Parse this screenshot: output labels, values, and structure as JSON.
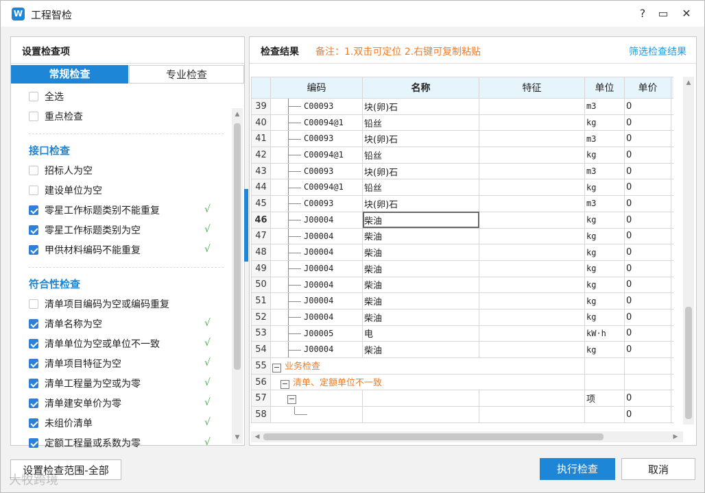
{
  "window": {
    "title": "工程智检",
    "logo": "W",
    "help": "?",
    "maximize": "▭",
    "close": "✕"
  },
  "left": {
    "title": "设置检查项",
    "tabs": [
      "常规检查",
      "专业检查"
    ],
    "items": [
      {
        "label": "全选",
        "checked": false
      },
      {
        "label": "重点检查",
        "checked": false
      }
    ],
    "sections": [
      {
        "title": "接口检查",
        "items": [
          {
            "label": "招标人为空",
            "checked": false
          },
          {
            "label": "建设单位为空",
            "checked": false
          },
          {
            "label": "零星工作标题类别不能重复",
            "checked": true
          },
          {
            "label": "零星工作标题类别为空",
            "checked": true
          },
          {
            "label": "甲供材料编码不能重复",
            "checked": true
          }
        ]
      },
      {
        "title": "符合性检查",
        "items": [
          {
            "label": "清单项目编码为空或编码重复",
            "checked": false
          },
          {
            "label": "清单名称为空",
            "checked": true
          },
          {
            "label": "清单单位为空或单位不一致",
            "checked": true
          },
          {
            "label": "清单项目特征为空",
            "checked": true
          },
          {
            "label": "清单工程量为空或为零",
            "checked": true
          },
          {
            "label": "清单建安单价为零",
            "checked": true
          },
          {
            "label": "未组价清单",
            "checked": true
          },
          {
            "label": "定额工程量或系数为零",
            "checked": true
          }
        ]
      }
    ],
    "tick_glyph": "√"
  },
  "right": {
    "title": "检查结果",
    "note": "备注：1.双击可定位 2.右键可复制粘贴",
    "filter_link": "筛选检查结果",
    "columns": [
      "编码",
      "名称",
      "特征",
      "单位",
      "单价"
    ],
    "rows": [
      {
        "no": "39",
        "code": "C00093",
        "name": "块(卵)石",
        "unit": "m3",
        "price": "0",
        "extra": "2C"
      },
      {
        "no": "40",
        "code": "C00094@1",
        "name": "铅丝",
        "unit": "kg",
        "price": "0",
        "extra": "2C"
      },
      {
        "no": "41",
        "code": "C00093",
        "name": "块(卵)石",
        "unit": "m3",
        "price": "0",
        "extra": "2C"
      },
      {
        "no": "42",
        "code": "C00094@1",
        "name": "铅丝",
        "unit": "kg",
        "price": "0",
        "extra": "2C"
      },
      {
        "no": "43",
        "code": "C00093",
        "name": "块(卵)石",
        "unit": "m3",
        "price": "0",
        "extra": "2C"
      },
      {
        "no": "44",
        "code": "C00094@1",
        "name": "铅丝",
        "unit": "kg",
        "price": "0",
        "extra": "2C"
      },
      {
        "no": "45",
        "code": "C00093",
        "name": "块(卵)石",
        "unit": "m3",
        "price": "0",
        "extra": "2C"
      },
      {
        "no": "46",
        "code": "J00004",
        "name": "柴油",
        "unit": "kg",
        "price": "0",
        "extra": "2C"
      },
      {
        "no": "47",
        "code": "J00004",
        "name": "柴油",
        "unit": "kg",
        "price": "0",
        "extra": "2C"
      },
      {
        "no": "48",
        "code": "J00004",
        "name": "柴油",
        "unit": "kg",
        "price": "0",
        "extra": "2C"
      },
      {
        "no": "49",
        "code": "J00004",
        "name": "柴油",
        "unit": "kg",
        "price": "0",
        "extra": "2C"
      },
      {
        "no": "50",
        "code": "J00004",
        "name": "柴油",
        "unit": "kg",
        "price": "0",
        "extra": "2C"
      },
      {
        "no": "51",
        "code": "J00004",
        "name": "柴油",
        "unit": "kg",
        "price": "0",
        "extra": "2C"
      },
      {
        "no": "52",
        "code": "J00004",
        "name": "柴油",
        "unit": "kg",
        "price": "0",
        "extra": "2C"
      },
      {
        "no": "53",
        "code": "J00005",
        "name": "电",
        "unit": "kW·h",
        "price": "0",
        "extra": "2C"
      },
      {
        "no": "54",
        "code": "J00004",
        "name": "柴油",
        "unit": "kg",
        "price": "0",
        "extra": "2C"
      }
    ],
    "groups": [
      {
        "no": "55",
        "label": "业务检查"
      },
      {
        "no": "56",
        "label": "清单、定额单位不一致"
      },
      {
        "no": "57",
        "unit": "项",
        "price": "0",
        "extra": "2C"
      },
      {
        "no": "58",
        "price": "0",
        "extra": "2C"
      }
    ]
  },
  "footer": {
    "scope_button": "设置检查范围-全部",
    "run_button": "执行检查",
    "cancel_button": "取消",
    "watermark": "大牧跨境"
  }
}
